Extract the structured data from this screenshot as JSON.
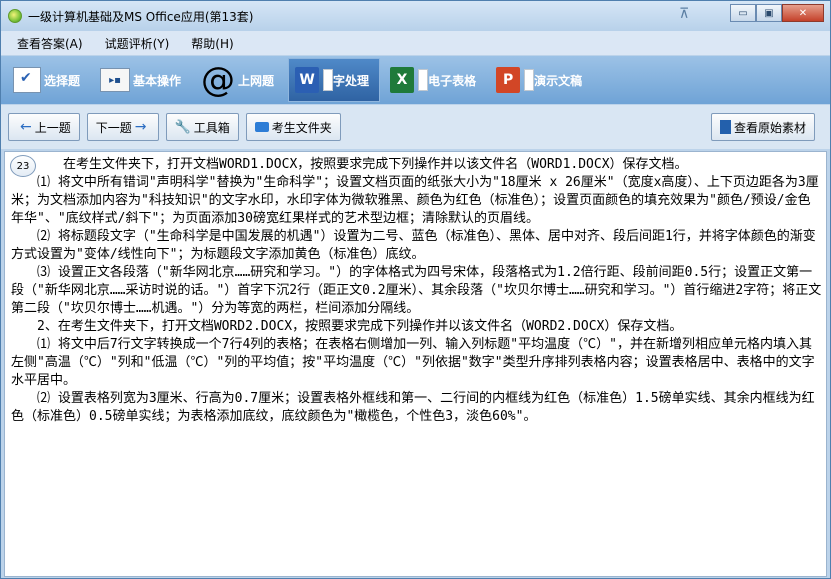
{
  "window": {
    "title": "一级计算机基础及MS Office应用(第13套)",
    "pin_glyph": "⊼",
    "minimize": "▭",
    "maximize": "▣",
    "close": "✕"
  },
  "menu": [
    "查看答案(A)",
    "试题评析(Y)",
    "帮助(H)"
  ],
  "tabs": [
    {
      "label": "选择题",
      "icon": "checklist-icon",
      "active": false
    },
    {
      "label": "基本操作",
      "icon": "window-icon",
      "active": false
    },
    {
      "label": "上网题",
      "icon": "at-icon",
      "active": false
    },
    {
      "label": "字处理",
      "icon": "word-icon",
      "active": true
    },
    {
      "label": "电子表格",
      "icon": "excel-icon",
      "active": false
    },
    {
      "label": "演示文稿",
      "icon": "powerpoint-icon",
      "active": false
    }
  ],
  "toolbar": {
    "prev": "上一题",
    "next": "下一题",
    "tools": "工具箱",
    "folder": "考生文件夹",
    "view_source": "查看原始素材"
  },
  "question": {
    "number": "23",
    "paragraphs": [
      "　　　　在考生文件夹下，打开文档WORD1.DOCX，按照要求完成下列操作并以该文件名（WORD1.DOCX）保存文档。",
      "　　⑴ 将文中所有错词\"声明科学\"替换为\"生命科学\"；设置文档页面的纸张大小为\"18厘米 x 26厘米\"（宽度x高度）、上下页边距各为3厘米；为文档添加内容为\"科技知识\"的文字水印，水印字体为微软雅黑、颜色为红色（标准色）；设置页面颜色的填充效果为\"颜色/预设/金色年华\"、\"底纹样式/斜下\"；为页面添加30磅宽红果样式的艺术型边框；清除默认的页眉线。",
      "　　⑵ 将标题段文字（\"生命科学是中国发展的机遇\"）设置为二号、蓝色（标准色）、黑体、居中对齐、段后间距1行，并将字体颜色的渐变方式设置为\"变体/线性向下\"；为标题段文字添加黄色（标准色）底纹。",
      "　　⑶ 设置正文各段落（\"新华网北京……研究和学习。\"）的字体格式为四号宋体，段落格式为1.2倍行距、段前间距0.5行；设置正文第一段（\"新华网北京……采访时说的话。\"）首字下沉2行（距正文0.2厘米）、其余段落（\"坎贝尔博士……研究和学习。\"）首行缩进2字符；将正文第二段（\"坎贝尔博士……机遇。\"）分为等宽的两栏，栏间添加分隔线。",
      "　　2、在考生文件夹下，打开文档WORD2.DOCX，按照要求完成下列操作并以该文件名（WORD2.DOCX）保存文档。",
      "　　⑴ 将文中后7行文字转换成一个7行4列的表格；在表格右侧增加一列、输入列标题\"平均温度（℃）\"，并在新增列相应单元格内填入其左侧\"高温（℃）\"列和\"低温（℃）\"列的平均值；按\"平均温度（℃）\"列依据\"数字\"类型升序排列表格内容；设置表格居中、表格中的文字水平居中。",
      "　　⑵ 设置表格列宽为3厘米、行高为0.7厘米；设置表格外框线和第一、二行间的内框线为红色（标准色）1.5磅单实线、其余内框线为红色（标准色）0.5磅单实线；为表格添加底纹，底纹颜色为\"橄榄色，个性色3，淡色60%\"。"
    ]
  }
}
